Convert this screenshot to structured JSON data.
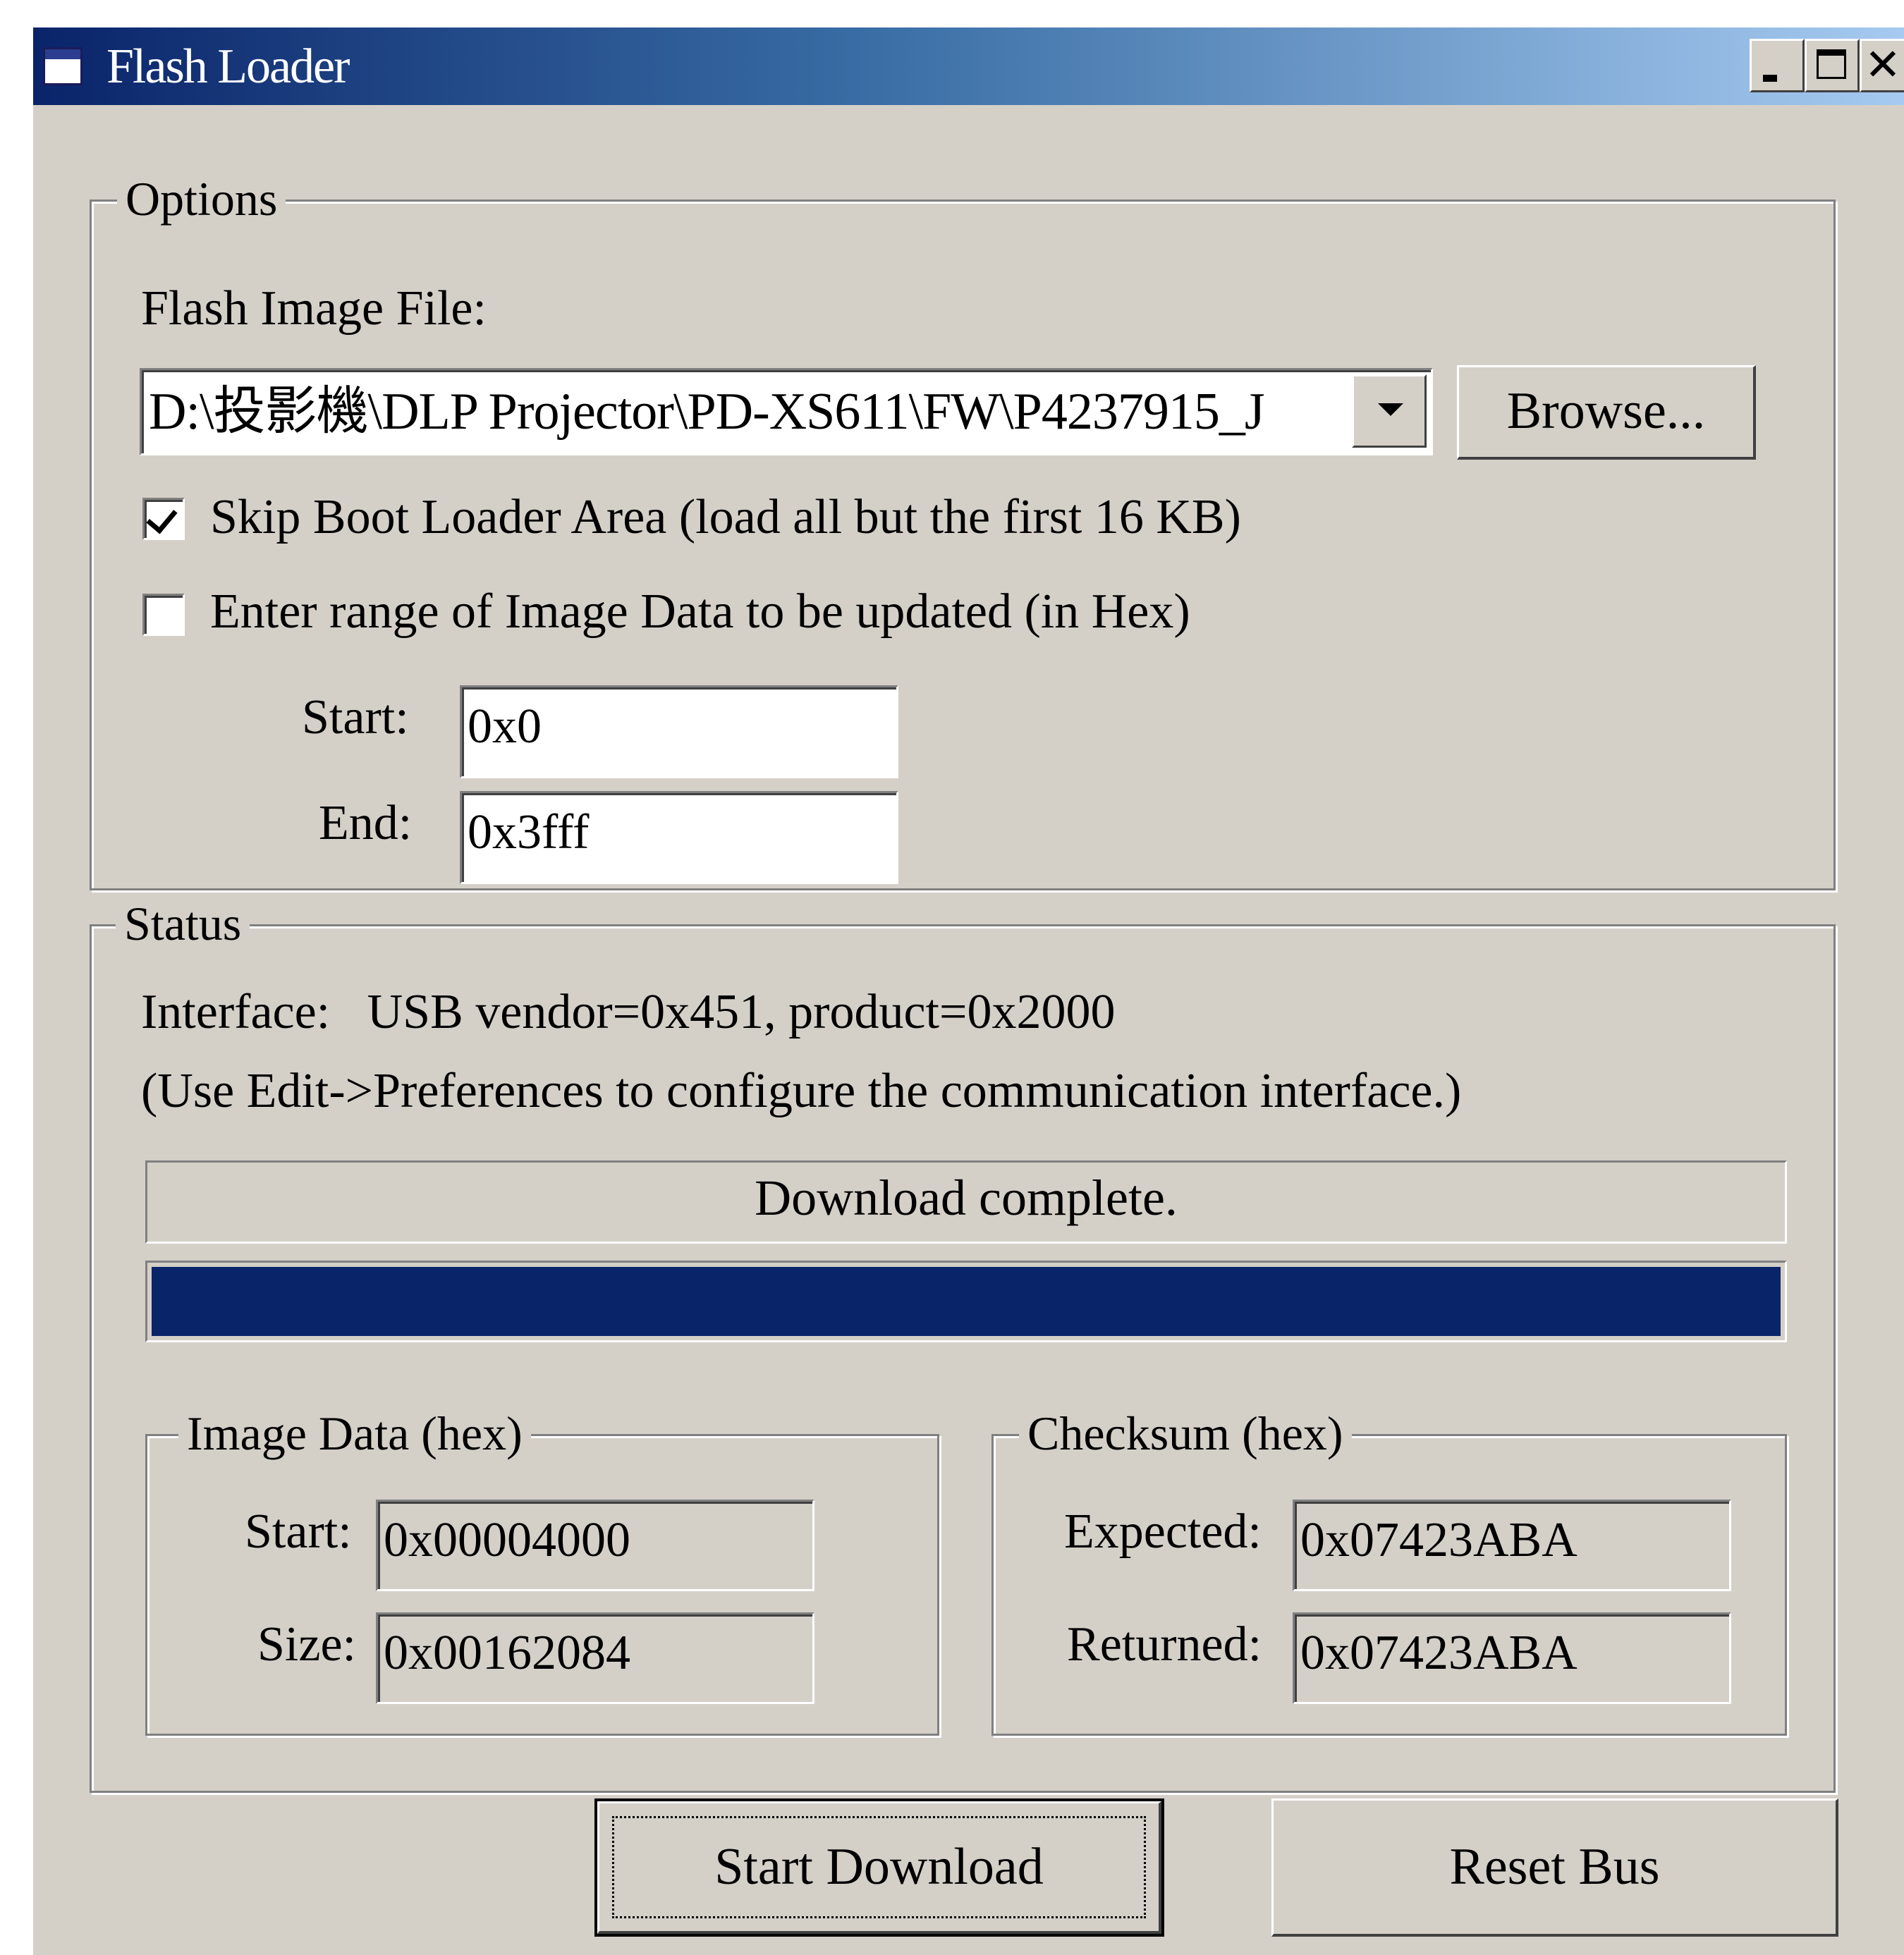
{
  "window": {
    "title": "Flash Loader",
    "close_glyph": "✕"
  },
  "options": {
    "legend": "Options",
    "image_file_label": "Flash Image File:",
    "image_file_value": "D:\\投影機\\DLP Projector\\PD-XS611\\FW\\P4237915_J",
    "browse_label": "Browse...",
    "skip_boot_label": "Skip Boot Loader Area (load all but the first 16 KB)",
    "skip_boot_checked": true,
    "range_label": "Enter range of Image Data to be updated (in Hex)",
    "range_checked": false,
    "start_label": "Start:",
    "start_value": "0x0",
    "end_label": "End:",
    "end_value": "0x3fff"
  },
  "status": {
    "legend": "Status",
    "interface_line": "Interface:   USB vendor=0x451, product=0x2000",
    "hint_line": "(Use Edit->Preferences to configure the communication interface.)",
    "message": "Download complete.",
    "progress_fraction": 1.0,
    "image_data": {
      "legend": "Image Data (hex)",
      "start_label": "Start:",
      "start_value": "0x00004000",
      "size_label": "Size:",
      "size_value": "0x00162084"
    },
    "checksum": {
      "legend": "Checksum (hex)",
      "expected_label": "Expected:",
      "expected_value": "0x07423ABA",
      "returned_label": "Returned:",
      "returned_value": "0x07423ABA"
    }
  },
  "buttons": {
    "start_download": "Start Download",
    "reset_bus": "Reset Bus"
  },
  "colors": {
    "face": "#d4d0c8",
    "title_start": "#0a246a",
    "title_end": "#a6caf0",
    "progress": "#0a246a"
  },
  "icons": {
    "app": "window-icon",
    "checkbox_check": "check-icon",
    "combo_arrow": "chevron-down-icon"
  }
}
